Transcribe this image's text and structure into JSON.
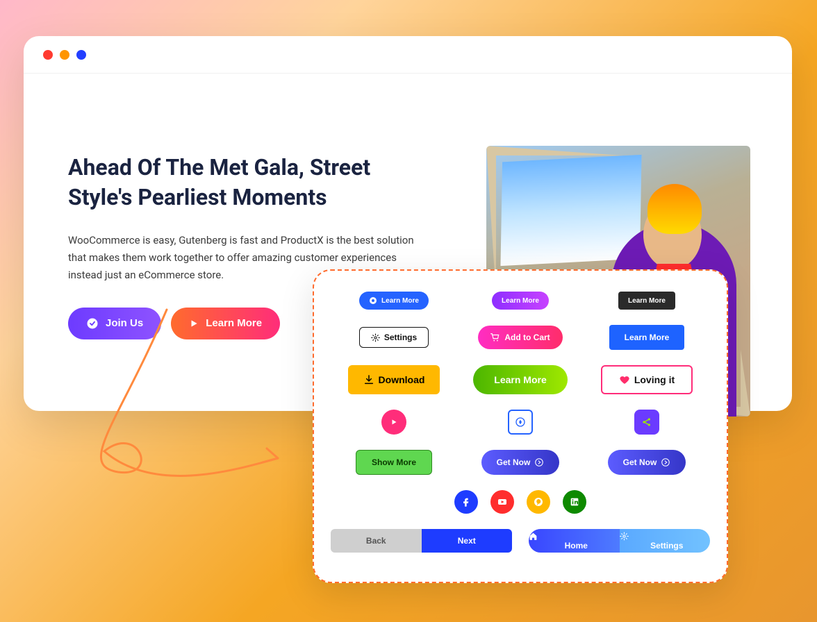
{
  "main": {
    "title": "Ahead Of The Met Gala, Street Style's Pearliest Moments",
    "desc": "WooCommerce is easy, Gutenberg is fast and ProductX is the best solution that makes them work together to offer amazing customer experiences instead just an eCommerce store.",
    "join_label": "Join Us",
    "learn_label": "Learn More"
  },
  "panel": {
    "r1": {
      "chat": "Learn More",
      "purple": "Learn More",
      "dark": "Learn More"
    },
    "r2": {
      "settings": "Settings",
      "cart": "Add to Cart",
      "blue": "Learn More"
    },
    "r3": {
      "download": "Download",
      "green": "Learn More",
      "love": "Loving it"
    },
    "r5": {
      "show": "Show More",
      "get1": "Get Now",
      "get2": "Get Now"
    },
    "footer": {
      "back": "Back",
      "next": "Next",
      "home": "Home",
      "settings": "Settings"
    }
  }
}
